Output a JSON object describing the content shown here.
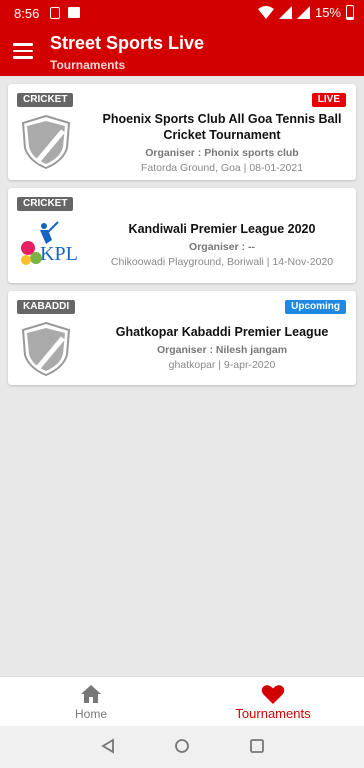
{
  "status_bar": {
    "time": "8:56",
    "battery": "15%"
  },
  "app_bar": {
    "title": "Street Sports Live",
    "subtitle": "Tournaments"
  },
  "tournaments": [
    {
      "sport": "CRICKET",
      "status": "LIVE",
      "title": "Phoenix Sports Club All Goa Tennis Ball Cricket Tournament",
      "organiser": "Organiser : Phonix sports club",
      "venue": "Fatorda Ground, Goa | 08-01-2021",
      "logo": "shield-icon"
    },
    {
      "sport": "CRICKET",
      "status": "",
      "title": "Kandiwali Premier League 2020",
      "organiser": "Organiser : --",
      "venue": "Chikoowadi Playground, Boriwali | 14-Nov-2020",
      "logo": "KPL",
      "logo_text": "KPL"
    },
    {
      "sport": "KABADDI",
      "status": "Upcoming",
      "title": "Ghatkopar Kabaddi Premier League",
      "organiser": "Organiser : Nilesh jangam",
      "venue": "ghatkopar | 9-apr-2020",
      "logo": "shield-icon"
    }
  ],
  "bottom_nav": {
    "home": "Home",
    "tournaments": "Tournaments",
    "active": "tournaments"
  },
  "colors": {
    "primary": "#d20000",
    "live": "#e60000",
    "upcoming": "#1e88e5"
  }
}
